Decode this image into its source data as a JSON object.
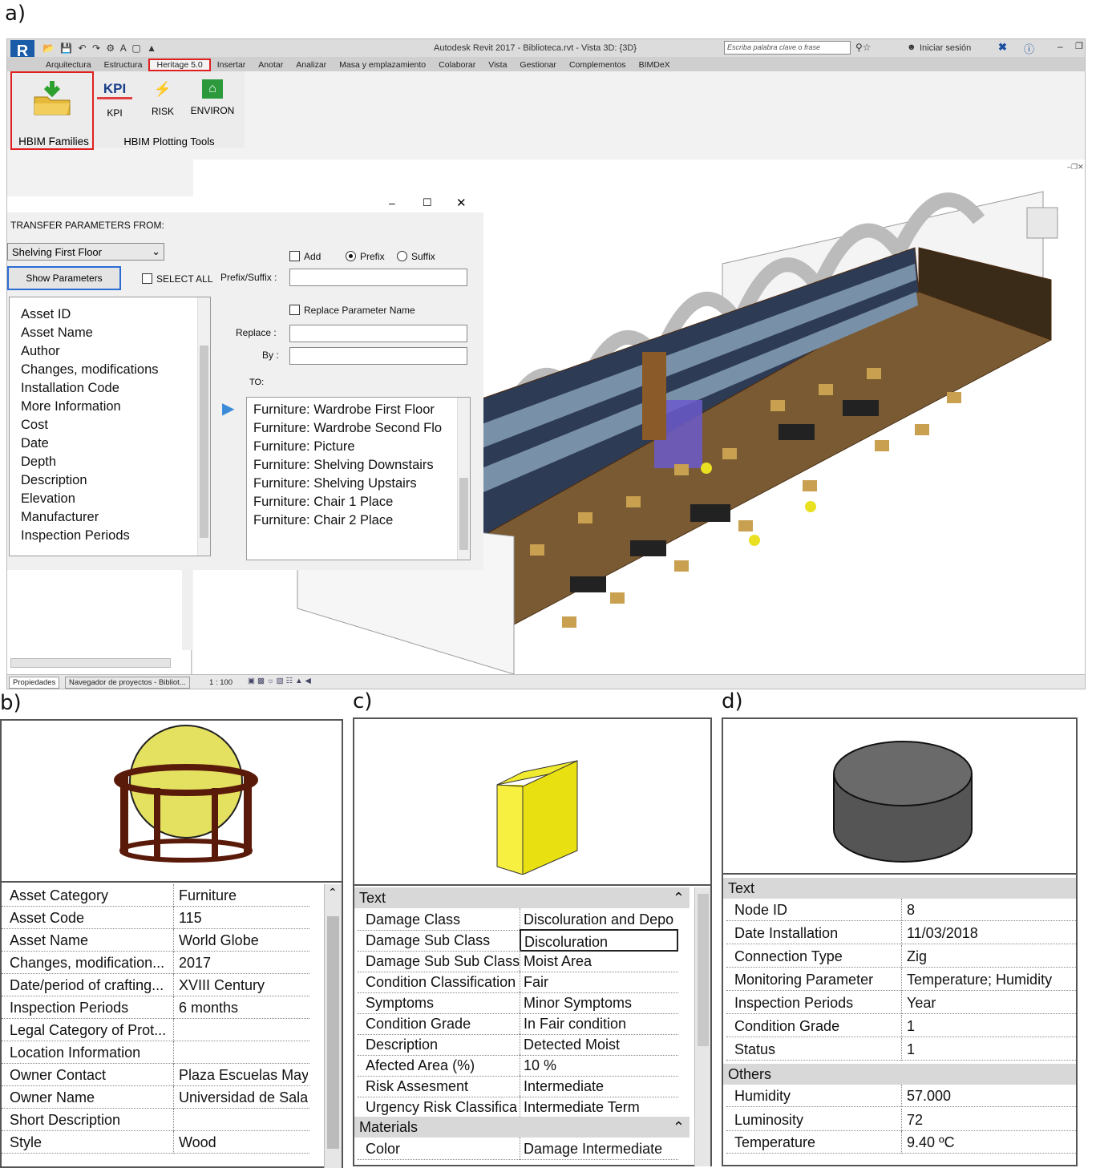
{
  "labels": {
    "a": "a)",
    "b": "b)",
    "c": "c)",
    "d": "d)"
  },
  "revit": {
    "title": "Autodesk Revit 2017 -     Biblioteca.rvt - Vista 3D: {3D}",
    "search_placeholder": "Escriba palabra clave o frase",
    "signin": "Iniciar sesión",
    "tabs": [
      "Arquitectura",
      "Estructura",
      "Heritage 5.0",
      "Insertar",
      "Anotar",
      "Analizar",
      "Masa y emplazamiento",
      "Colaborar",
      "Vista",
      "Gestionar",
      "Complementos",
      "BIMDeX"
    ],
    "ribbon": {
      "hbim_families": "HBIM Families",
      "kpi_icon": "KPI",
      "kpi": "KPI",
      "risk": "RISK",
      "environ": "ENVIRON",
      "plotting_tools": "HBIM Plotting Tools"
    },
    "status": {
      "tab_properties": "Propiedades",
      "tab_browser": "Navegador de proyectos - Bibliot...",
      "scale": "1 : 100"
    }
  },
  "dialog": {
    "transfer_from": "TRANSFER PARAMETERS FROM:",
    "source_select": "Shelving First Floor",
    "show_button": "Show Parameters",
    "select_all": "SELECT ALL",
    "add": "Add",
    "prefix": "Prefix",
    "suffix": "Suffix",
    "prefix_suffix_label": "Prefix/Suffix :",
    "replace_name": "Replace Parameter Name",
    "replace_label": "Replace :",
    "by_label": "By :",
    "to_label": "TO:",
    "parameters": [
      "Asset ID",
      "Asset Name",
      "Author",
      "Changes, modifications",
      "Installation Code",
      "More Information",
      "Cost",
      "Date",
      "Depth",
      "Description",
      "Elevation",
      "Manufacturer",
      "Inspection Periods"
    ],
    "targets": [
      "Furniture: Wardrobe First Floor",
      "Furniture: Wardrobe Second Flo",
      "Furniture: Picture",
      "Furniture: Shelving Downstairs",
      "Furniture: Shelving Upstairs",
      "Furniture: Chair 1 Place",
      "Furniture: Chair 2 Place"
    ]
  },
  "panel_b": {
    "rows": [
      [
        "Asset Category",
        "Furniture"
      ],
      [
        "Asset Code",
        "115"
      ],
      [
        "Asset Name",
        "World Globe"
      ],
      [
        "Changes, modification...",
        "2017"
      ],
      [
        "Date/period of crafting...",
        "XVIII Century"
      ],
      [
        "Inspection Periods",
        "6 months"
      ],
      [
        "Legal Category of Prot...",
        ""
      ],
      [
        "Location Information",
        ""
      ],
      [
        "Owner Contact",
        "Plaza Escuelas May"
      ],
      [
        "Owner Name",
        "Universidad de Sala"
      ],
      [
        "Short Description",
        ""
      ],
      [
        "Style",
        "Wood"
      ]
    ]
  },
  "panel_c": {
    "group_text": "Text",
    "rows": [
      [
        "Damage Class",
        "Discoluration and Depo"
      ],
      [
        "Damage Sub Class",
        "Discoluration"
      ],
      [
        "Damage Sub Sub Class",
        "Moist Area"
      ],
      [
        "Condition Classification",
        "Fair"
      ],
      [
        "Symptoms",
        "Minor Symptoms"
      ],
      [
        "Condition Grade",
        "In Fair condition"
      ],
      [
        "Description",
        "Detected Moist"
      ],
      [
        "Afected Area (%)",
        "10 %"
      ],
      [
        "Risk Assesment",
        "Intermediate"
      ],
      [
        "Urgency Risk Classifica",
        "Intermediate Term"
      ]
    ],
    "group_materials": "Materials",
    "materials_rows": [
      [
        "Color",
        "Damage Intermediate"
      ]
    ]
  },
  "panel_d": {
    "group_text": "Text",
    "rows": [
      [
        "Node ID",
        "8"
      ],
      [
        "Date Installation",
        "11/03/2018"
      ],
      [
        "Connection Type",
        "Zig"
      ],
      [
        "Monitoring Parameter",
        "Temperature; Humidity"
      ],
      [
        "Inspection Periods",
        "Year"
      ],
      [
        "Condition Grade",
        "1"
      ],
      [
        "Status",
        "1"
      ]
    ],
    "group_others": "Others",
    "others_rows": [
      [
        "Humidity",
        "57.000"
      ],
      [
        "Luminosity",
        "72"
      ],
      [
        "Temperature",
        "9.40 ºC"
      ]
    ]
  }
}
